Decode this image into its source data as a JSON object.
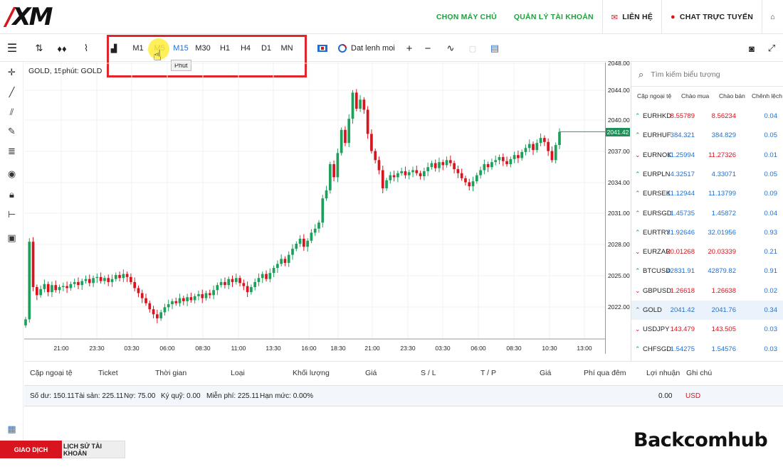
{
  "brand": {
    "logo_text": "XM",
    "watermark": "Backcomhub"
  },
  "topnav": {
    "items": [
      {
        "label": "CHỌN MÁY CHỦ"
      },
      {
        "label": "QUẢN LÝ TÀI KHOẢN"
      },
      {
        "label": "LIÊN HỆ",
        "icon": "mail-icon"
      },
      {
        "label": "CHAT TRỰC TUYẾN",
        "icon": "chat-icon"
      }
    ],
    "home_icon": "home-icon"
  },
  "toolbar": {
    "timeframes": [
      "M1",
      "M5",
      "M15",
      "M30",
      "H1",
      "H4",
      "D1",
      "MN"
    ],
    "active_timeframe": "M15",
    "hovered_timeframe": "M5",
    "tooltip": "Phút",
    "order_label": "Dat lenh moi",
    "highlight_color": "#e0262a"
  },
  "chart": {
    "title": "GOLD, 15phút:  GOLD",
    "current_price": "2041.42",
    "y_ticks": [
      "2048.00",
      "2044.00",
      "2040.00",
      "2037.00",
      "2034.00",
      "2031.00",
      "2028.00",
      "2025.00",
      "2022.00"
    ],
    "x_ticks": [
      "21:00",
      "23:30",
      "03:30",
      "06:00",
      "08:30",
      "11:00",
      "13:30",
      "16:00",
      "18:30",
      "21:00",
      "23:30",
      "03:30",
      "06:00",
      "08:30",
      "10:30",
      "13:00"
    ],
    "up_color": "#1f9f5c",
    "down_color": "#d8141e"
  },
  "chart_data": {
    "type": "candlestick",
    "ylim": [
      2020.5,
      2048.0
    ],
    "closes": [
      2022.8,
      2030.5,
      2026.0,
      2025.2,
      2025.8,
      2026.3,
      2025.5,
      2026.2,
      2025.7,
      2026.0,
      2026.1,
      2025.9,
      2026.3,
      2026.5,
      2026.2,
      2026.6,
      2026.8,
      2026.4,
      2026.9,
      2027.0,
      2026.6,
      2026.9,
      2026.5,
      2026.8,
      2027.2,
      2026.9,
      2027.3,
      2027.0,
      2026.5,
      2025.9,
      2025.4,
      2024.9,
      2024.4,
      2023.8,
      2023.3,
      2022.9,
      2023.5,
      2024.0,
      2024.3,
      2024.6,
      2024.4,
      2024.9,
      2024.6,
      2025.0,
      2024.7,
      2025.1,
      2025.3,
      2024.9,
      2025.4,
      2025.2,
      2025.7,
      2026.2,
      2026.5,
      2026.2,
      2026.8,
      2026.5,
      2026.9,
      2026.4,
      2026.1,
      2025.5,
      2026.0,
      2026.5,
      2026.9,
      2027.3,
      2026.8,
      2027.4,
      2027.9,
      2028.3,
      2028.8,
      2028.4,
      2029.2,
      2029.8,
      2030.3,
      2030.8,
      2030.0,
      2030.6,
      2031.4,
      2031.8,
      2032.4,
      2034.8,
      2035.6,
      2038.2,
      2036.9,
      2039.3,
      2041.6,
      2040.3,
      2042.7,
      2045.3,
      2043.7,
      2044.6,
      2043.6,
      2041.2,
      2039.5,
      2038.6,
      2037.6,
      2035.8,
      2036.6,
      2037.1,
      2036.9,
      2037.3,
      2037.5,
      2037.1,
      2037.4,
      2037.6,
      2037.3,
      2037.0,
      2037.5,
      2037.9,
      2038.3,
      2037.8,
      2038.4,
      2038.1,
      2038.6,
      2038.3,
      2037.7,
      2037.3,
      2036.8,
      2036.4,
      2036.0,
      2036.5,
      2037.1,
      2037.6,
      2038.2,
      2037.9,
      2038.4,
      2038.6,
      2038.9,
      2038.5,
      2038.2,
      2038.7,
      2039.1,
      2038.8,
      2039.4,
      2039.8,
      2040.2,
      2039.6,
      2040.3,
      2040.8,
      2040.4,
      2039.5,
      2038.6,
      2040.1,
      2041.4
    ],
    "xlabel": "",
    "ylabel": ""
  },
  "market": {
    "search_placeholder": "Tìm kiếm biểu tượng",
    "headers": [
      "Cặp ngoại tệ",
      "Chào mua",
      "Chào bán",
      "Chênh lệch"
    ],
    "rows": [
      {
        "symbol": "EURHKD",
        "dir": "up",
        "bid": "8.55789",
        "bid_color": "red",
        "ask": "8.56234",
        "ask_color": "red",
        "spread": "0.04"
      },
      {
        "symbol": "EURHUF",
        "dir": "up",
        "bid": "384.321",
        "bid_color": "blue",
        "ask": "384.829",
        "ask_color": "blue",
        "spread": "0.05"
      },
      {
        "symbol": "EURNOK",
        "dir": "down",
        "bid": "11.25994",
        "bid_color": "blue",
        "ask": "11.27326",
        "ask_color": "red",
        "spread": "0.01"
      },
      {
        "symbol": "EURPLN",
        "dir": "up",
        "bid": "4.32517",
        "bid_color": "blue",
        "ask": "4.33071",
        "ask_color": "blue",
        "spread": "0.05"
      },
      {
        "symbol": "EURSEK",
        "dir": "up",
        "bid": "11.12944",
        "bid_color": "blue",
        "ask": "11.13799",
        "ask_color": "blue",
        "spread": "0.09"
      },
      {
        "symbol": "EURSGD",
        "dir": "up",
        "bid": "1.45735",
        "bid_color": "blue",
        "ask": "1.45872",
        "ask_color": "blue",
        "spread": "0.04"
      },
      {
        "symbol": "EURTRY",
        "dir": "up",
        "bid": "31.92646",
        "bid_color": "blue",
        "ask": "32.01956",
        "ask_color": "blue",
        "spread": "0.93"
      },
      {
        "symbol": "EURZAR",
        "dir": "down",
        "bid": "20.01268",
        "bid_color": "red",
        "ask": "20.03339",
        "ask_color": "red",
        "spread": "0.21"
      },
      {
        "symbol": "BTCUSD",
        "dir": "up",
        "bid": "42831.91",
        "bid_color": "blue",
        "ask": "42879.82",
        "ask_color": "blue",
        "spread": "0.91"
      },
      {
        "symbol": "GBPUSD",
        "dir": "down",
        "bid": "1.26618",
        "bid_color": "red",
        "ask": "1.26638",
        "ask_color": "red",
        "spread": "0.02"
      },
      {
        "symbol": "GOLD",
        "dir": "up",
        "bid": "2041.42",
        "bid_color": "blue",
        "ask": "2041.76",
        "ask_color": "blue",
        "spread": "0.34",
        "selected": true
      },
      {
        "symbol": "USDJPY",
        "dir": "down",
        "bid": "143.479",
        "bid_color": "red",
        "ask": "143.505",
        "ask_color": "red",
        "spread": "0.03"
      },
      {
        "symbol": "CHFSGD",
        "dir": "up",
        "bid": "1.54275",
        "bid_color": "blue",
        "ask": "1.54576",
        "ask_color": "blue",
        "spread": "0.03"
      }
    ]
  },
  "positions": {
    "headers": [
      "Cặp ngoại tệ",
      "Ticket",
      "Thời gian",
      "Loại",
      "Khối lượng",
      "Giá",
      "S / L",
      "T / P",
      "Giá",
      "Phí qua đêm",
      "Lợi nhuận",
      "Ghi chú"
    ]
  },
  "balance": {
    "so_du": "Số dư: 150.11",
    "tai_san": "Tài sản: 225.11",
    "no": "Nợ: 75.00",
    "ky_quy": "Ký quỹ: 0.00",
    "mien_phi": "Miễn phí: 225.11",
    "han_muc": "Hạn mức: 0.00%",
    "profit": "0.00",
    "currency": "USD"
  },
  "bottom_tabs": [
    "GIAO DỊCH",
    "LỊCH SỬ TÀI KHOẢN"
  ]
}
